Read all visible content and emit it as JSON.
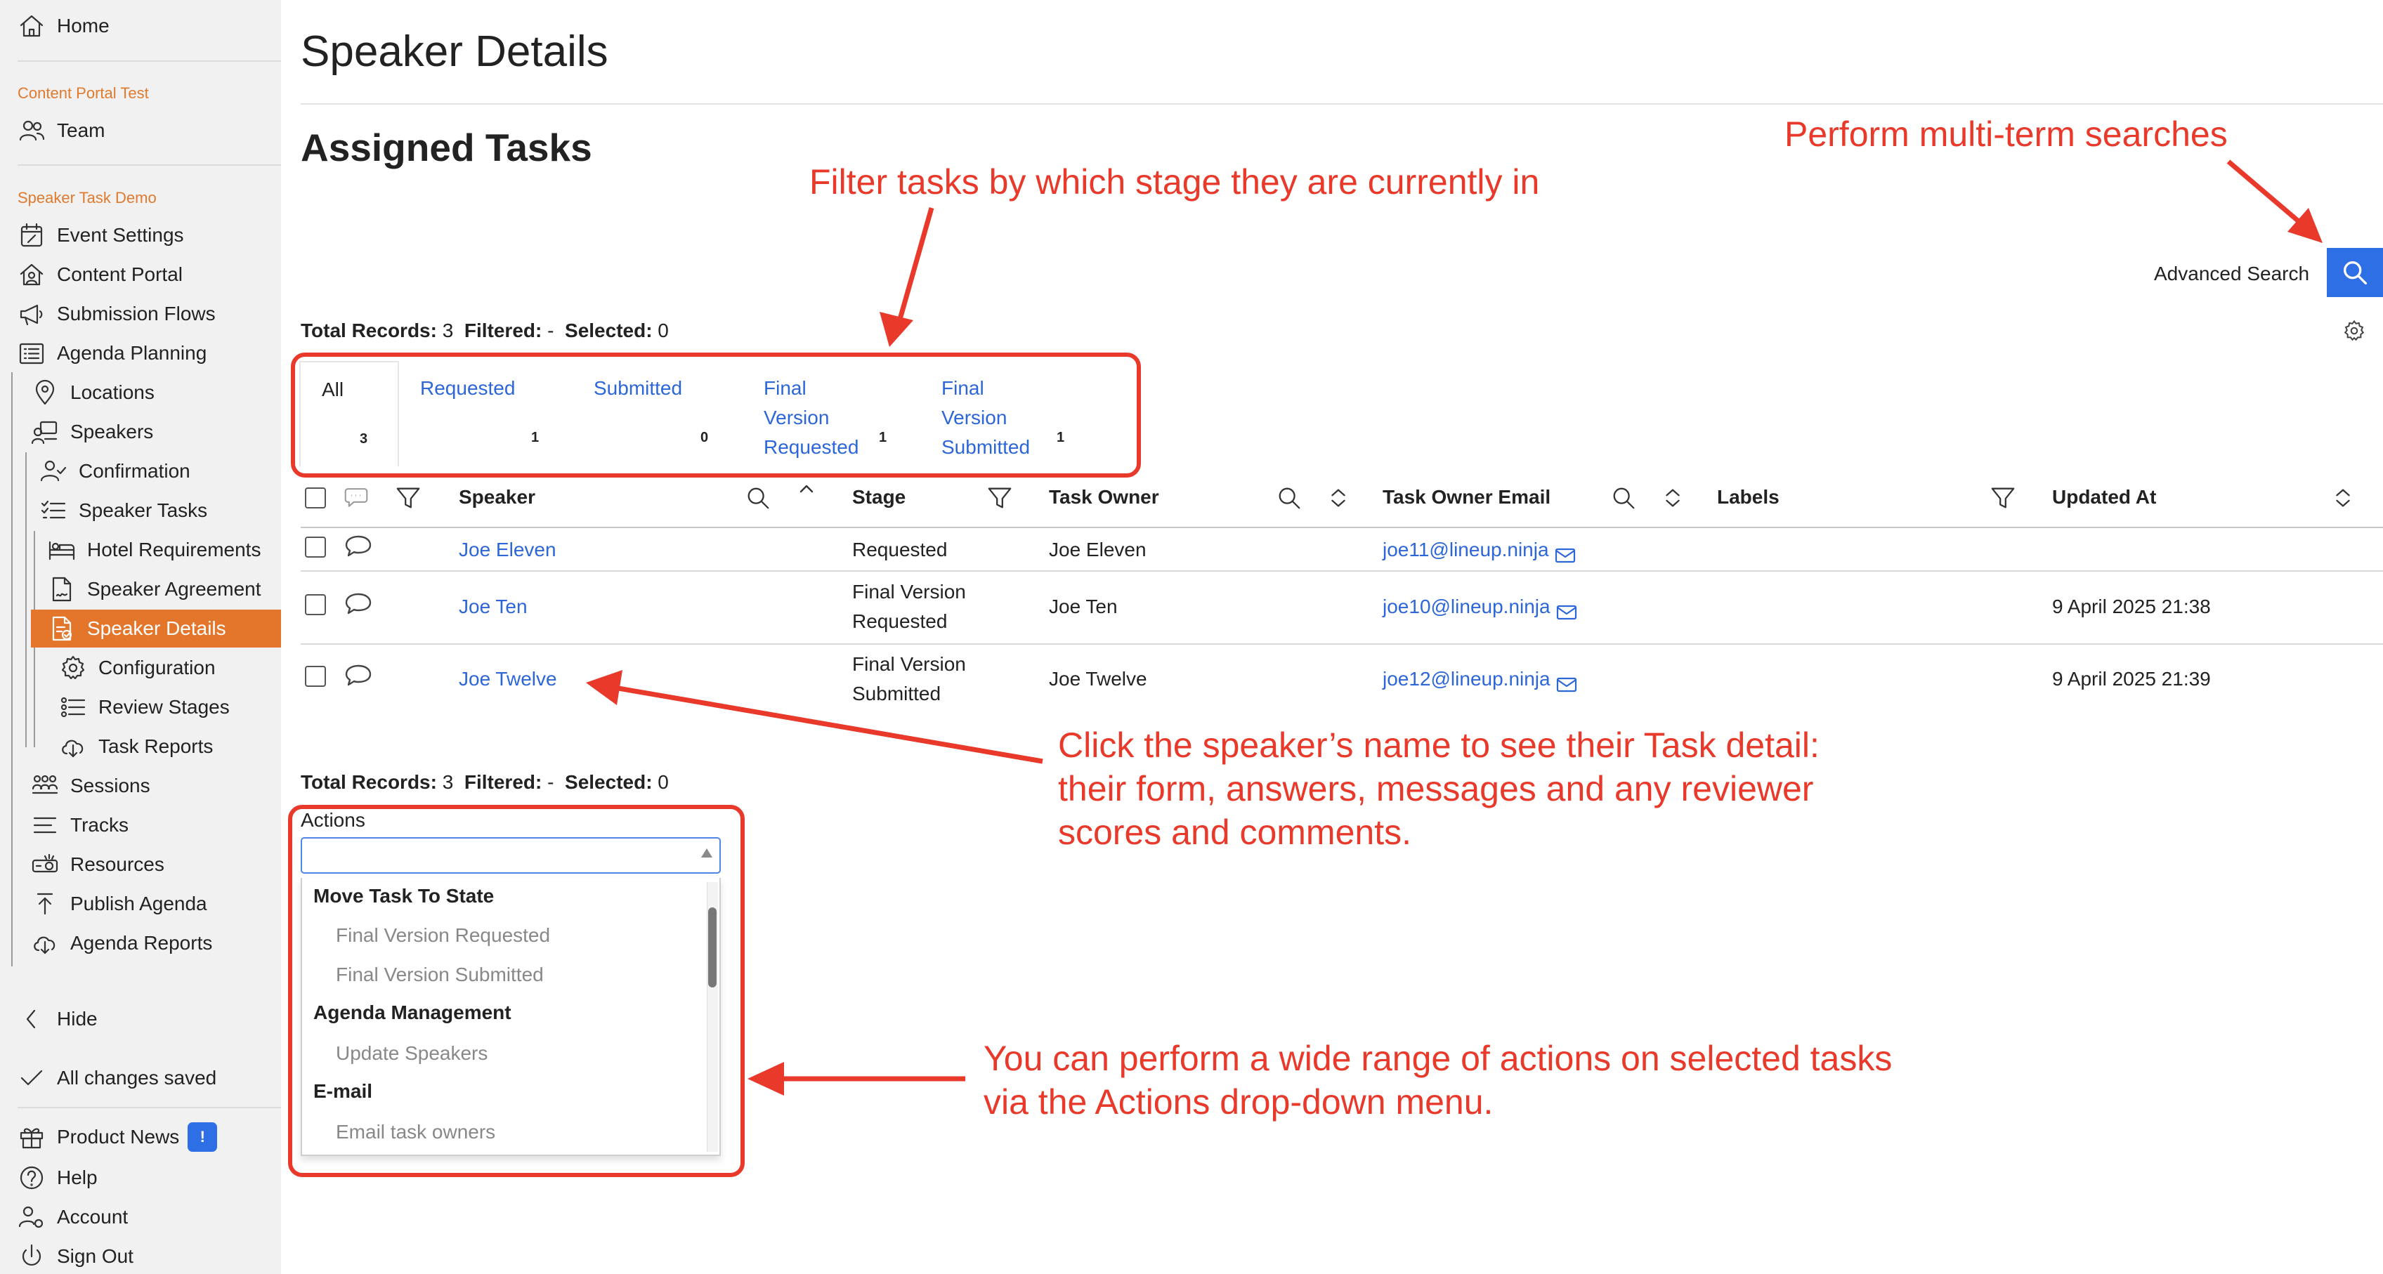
{
  "sidebar": {
    "home": "Home",
    "section1": "Content Portal Test",
    "team": "Team",
    "section2": "Speaker Task Demo",
    "items": [
      "Event Settings",
      "Content Portal",
      "Submission Flows",
      "Agenda Planning",
      "Locations",
      "Speakers",
      "Confirmation",
      "Speaker Tasks",
      "Hotel Requirements",
      "Speaker Agreement",
      "Speaker Details",
      "Configuration",
      "Review Stages",
      "Task Reports",
      "Sessions",
      "Tracks",
      "Resources",
      "Publish Agenda",
      "Agenda Reports"
    ],
    "hide": "Hide",
    "saved": "All changes saved",
    "product_news": "Product News",
    "product_news_badge": "!",
    "help": "Help",
    "account": "Account",
    "sign_out": "Sign Out",
    "accent_color": "#e4762c"
  },
  "page": {
    "title": "Speaker Details",
    "subtitle": "Assigned Tasks",
    "advanced_search": "Advanced Search"
  },
  "records": {
    "total_label": "Total Records:",
    "total": "3",
    "filtered_label": "Filtered:",
    "filtered": "-",
    "selected_label": "Selected:",
    "selected": "0"
  },
  "tabs": [
    {
      "label": "All",
      "count": "3"
    },
    {
      "label": "Requested",
      "count": "1"
    },
    {
      "label": "Submitted",
      "count": "0"
    },
    {
      "label": "Final Version Requested",
      "count": "1"
    },
    {
      "label": "Final Version Submitted",
      "count": "1"
    }
  ],
  "table": {
    "columns": [
      "Speaker",
      "Stage",
      "Task Owner",
      "Task Owner Email",
      "Labels",
      "Updated At"
    ],
    "rows": [
      {
        "speaker": "Joe Eleven",
        "stage": "Requested",
        "owner": "Joe Eleven",
        "email": "joe11@lineup.ninja",
        "labels": "",
        "updated": ""
      },
      {
        "speaker": "Joe Ten",
        "stage": "Final Version Requested",
        "owner": "Joe Ten",
        "email": "joe10@lineup.ninja",
        "labels": "",
        "updated": "9 April 2025 21:38"
      },
      {
        "speaker": "Joe Twelve",
        "stage": "Final Version Submitted",
        "owner": "Joe Twelve",
        "email": "joe12@lineup.ninja",
        "labels": "",
        "updated": "9 April 2025 21:39"
      }
    ]
  },
  "actions": {
    "label": "Actions",
    "value": "",
    "groups": [
      {
        "name": "Move Task To State",
        "options": [
          "Final Version Requested",
          "Final Version Submitted"
        ]
      },
      {
        "name": "Agenda Management",
        "options": [
          "Update Speakers"
        ]
      },
      {
        "name": "E-mail",
        "options": [
          "Email task owners"
        ]
      }
    ]
  },
  "annotations": {
    "filter": "Filter tasks by which stage they are currently in",
    "search": "Perform multi-term searches",
    "speaker": [
      "Click the speaker’s name to see their Task detail:",
      "their form, answers, messages and any reviewer",
      "scores and comments."
    ],
    "actions": [
      "You can perform a wide range of actions on selected tasks",
      "via the Actions drop-down menu."
    ],
    "color": "#e8392a"
  },
  "link_color": "#2d66d8"
}
